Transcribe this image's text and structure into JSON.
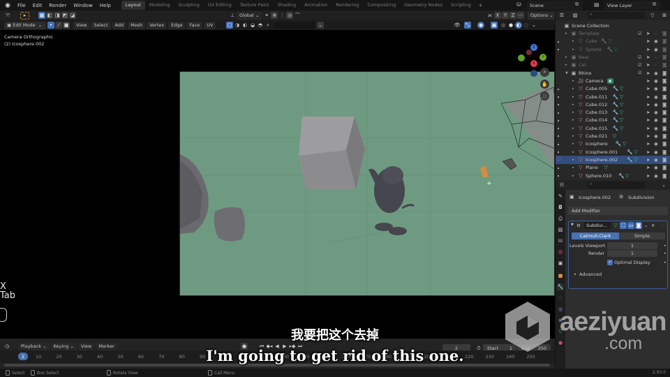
{
  "topbar": {
    "menu": [
      "File",
      "Edit",
      "Render",
      "Window",
      "Help"
    ],
    "workspaces": [
      "Layout",
      "Modeling",
      "Sculpting",
      "UV Editing",
      "Texture Paint",
      "Shading",
      "Animation",
      "Rendering",
      "Compositing",
      "Geometry Nodes",
      "Scripting"
    ],
    "active_workspace": "Layout",
    "add_workspace": "+",
    "scene": "Scene",
    "view_layer": "View Layer"
  },
  "tool_header": {
    "orientation": "Global",
    "axes": [
      "X",
      "Y",
      "Z"
    ],
    "options": "Options"
  },
  "viewport_header": {
    "mode": "Edit Mode",
    "menus": [
      "View",
      "Select",
      "Add",
      "Mesh",
      "Vertex",
      "Edge",
      "Face",
      "UV"
    ]
  },
  "viewport": {
    "view_name": "Camera Orthographic",
    "object_info": "(2) Icosphere.002",
    "key_hint_x": "X",
    "key_hint_tab": "Tab",
    "gizmo": {
      "x": "X",
      "y": "Y",
      "z": "Z"
    },
    "camera_bg_color": "#6f9a82"
  },
  "subtitles": {
    "chinese": "我要把这个去掉",
    "english": "I'm going to get rid of this one."
  },
  "timeline": {
    "menus": [
      "Playback",
      "Keying",
      "View",
      "Marker"
    ],
    "current_frame": "2",
    "start_label": "Start",
    "start": "1",
    "end_label": "End",
    "end": "250",
    "ticks": [
      "10",
      "20",
      "30",
      "40",
      "50",
      "60",
      "70",
      "80",
      "90",
      "100",
      "110",
      "120",
      "130",
      "140",
      "150",
      "160",
      "170",
      "180",
      "190",
      "200",
      "210",
      "220",
      "230",
      "240",
      "250"
    ],
    "playhead": "2"
  },
  "statusbar": {
    "select": "Select",
    "box_select": "Box Select",
    "rotate_view": "Rotate View",
    "call_menu": "Call Menu",
    "version": "2.93.0"
  },
  "outliner": {
    "root": "Scene Collection",
    "rows": [
      {
        "name": "Template",
        "type": "collection",
        "depth": 1,
        "dim": true,
        "check": true
      },
      {
        "name": "Cube",
        "type": "mesh",
        "depth": 2,
        "dim": true,
        "mod": true
      },
      {
        "name": "Sphere",
        "type": "mesh",
        "depth": 2,
        "dim": true,
        "mod": true
      },
      {
        "name": "Bear",
        "type": "collection",
        "depth": 1,
        "dim": true,
        "check": true
      },
      {
        "name": "Cat",
        "type": "collection",
        "depth": 1,
        "dim": true,
        "check": true
      },
      {
        "name": "Rhino",
        "type": "collection",
        "depth": 1,
        "dim": false,
        "check": true
      },
      {
        "name": "Camera",
        "type": "camera",
        "depth": 2,
        "dim": false
      },
      {
        "name": "Cube.005",
        "type": "mesh",
        "depth": 2,
        "dim": false,
        "mod": true
      },
      {
        "name": "Cube.011",
        "type": "mesh",
        "depth": 2,
        "dim": false,
        "mod": true
      },
      {
        "name": "Cube.012",
        "type": "mesh",
        "depth": 2,
        "dim": false,
        "mod": true
      },
      {
        "name": "Cube.013",
        "type": "mesh",
        "depth": 2,
        "dim": false,
        "mod": true
      },
      {
        "name": "Cube.014",
        "type": "mesh",
        "depth": 2,
        "dim": false,
        "mod": true
      },
      {
        "name": "Cube.015",
        "type": "mesh",
        "depth": 2,
        "dim": false,
        "mod": true
      },
      {
        "name": "Cube.021",
        "type": "mesh",
        "depth": 2,
        "dim": false,
        "mod": false
      },
      {
        "name": "Icosphere",
        "type": "mesh",
        "depth": 2,
        "dim": false,
        "mod": true
      },
      {
        "name": "Icosphere.001",
        "type": "mesh",
        "depth": 2,
        "dim": false,
        "mod": true
      },
      {
        "name": "Icosphere.002",
        "type": "mesh",
        "depth": 2,
        "dim": false,
        "mod": true,
        "selected": true
      },
      {
        "name": "Plane",
        "type": "mesh",
        "depth": 2,
        "dim": false,
        "mod": false
      },
      {
        "name": "Sphere.010",
        "type": "mesh",
        "depth": 2,
        "dim": false,
        "mod": true
      }
    ]
  },
  "properties": {
    "object": "Icosphere.002",
    "modifier_crumb": "Subdivision",
    "add_modifier": "Add Modifier",
    "modifier_name": "Subdivi...",
    "type_catmull": "Catmull-Clark",
    "type_simple": "Simple",
    "levels_viewport_label": "Levels Viewport",
    "levels_viewport": "1",
    "render_label": "Render",
    "render": "1",
    "optimal_display": "Optimal Display",
    "advanced": "Advanced"
  },
  "watermark": {
    "text": "aeziyuan",
    "domain": ".com"
  }
}
